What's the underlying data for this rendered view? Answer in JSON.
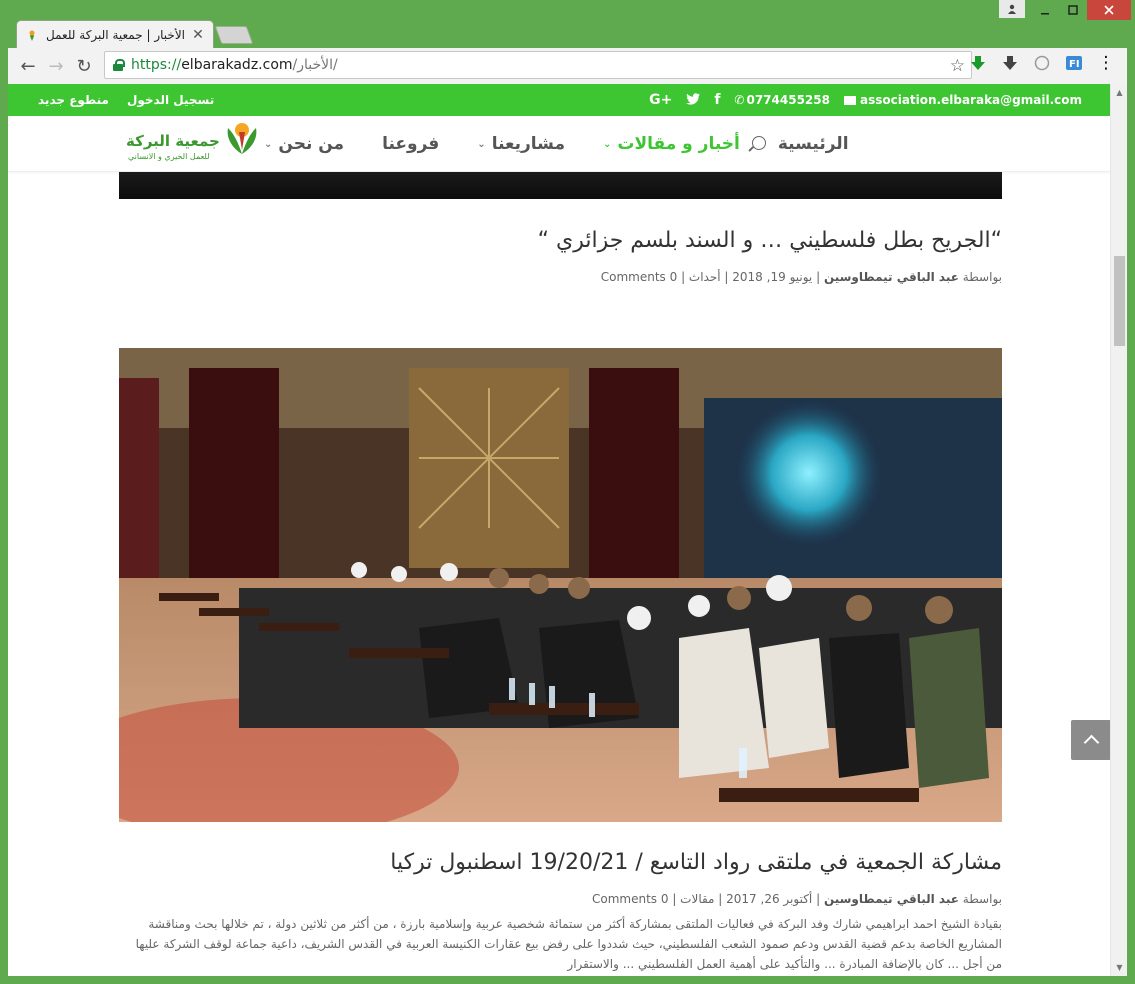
{
  "browser": {
    "tab_title": "الأخبار | جمعية البركة للعمل",
    "url_scheme": "https://",
    "url_host": "elbarakadz.com",
    "url_path": "/الأخبار/",
    "close_glyph": "✕",
    "back_glyph": "←",
    "forward_glyph": "→",
    "reload_glyph": "↻",
    "star_glyph": "☆",
    "menu_glyph": "⋮"
  },
  "topbar": {
    "left_links": [
      "منطوع جديد",
      "تسجيل الدخول"
    ],
    "email": "association.elbaraka@gmail.com",
    "phone": "0774455258",
    "social": [
      "G+",
      "t",
      "f"
    ]
  },
  "header": {
    "logo_title": "جمعية البركة",
    "logo_subtitle": "للعمل الخيري و الانساني",
    "nav": [
      {
        "label": "الرئيسية",
        "has_dropdown": false,
        "active": false
      },
      {
        "label": "أخبار و مقالات",
        "has_dropdown": true,
        "active": true
      },
      {
        "label": "مشاريعنا",
        "has_dropdown": true,
        "active": false
      },
      {
        "label": "فروعنا",
        "has_dropdown": false,
        "active": false
      },
      {
        "label": "من نحن",
        "has_dropdown": true,
        "active": false
      }
    ]
  },
  "posts": [
    {
      "title": "“الجريح بطل فلسطيني … و السند بلسم جزائري “",
      "meta_prefix": "بواسطة",
      "author": "عبد الباقي تيمطاوسين",
      "date": "يونيو 19, 2018",
      "category": "أحداث",
      "comments": "0 Comments"
    },
    {
      "title": "مشاركة الجمعية في ملتقى رواد التاسع / 19/20/21 اسطنبول تركيا",
      "meta_prefix": "بواسطة",
      "author": "عبد الباقي تيمطاوسين",
      "date": "أكتوبر 26, 2017",
      "category": "مقالات",
      "comments": "0 Comments",
      "excerpt": "بقيادة الشيخ احمد ابراهيمي شارك وفد البركة في فعاليات الملتقى بمشاركة أكثر من ستمائة شخصية عربية وإسلامية بارزة ، من أكثر من ثلاثين دولة ، تم خلالها بحث ومناقشة المشاريع الخاصة بدعم قضية القدس ودعم صمود الشعب الفلسطيني، حيث شددوا على رفض بيع عقارات الكنيسة العربية في القدس الشريف، داعية جماعة لوقف الشركة عليها من أجل ... كان بالإضافة المبادرة ... والتأكيد على أهمية العمل الفلسطيني ... والاستقرار"
    }
  ],
  "colors": {
    "brand_green": "#3ec532",
    "chrome_green": "#5fa94f"
  }
}
